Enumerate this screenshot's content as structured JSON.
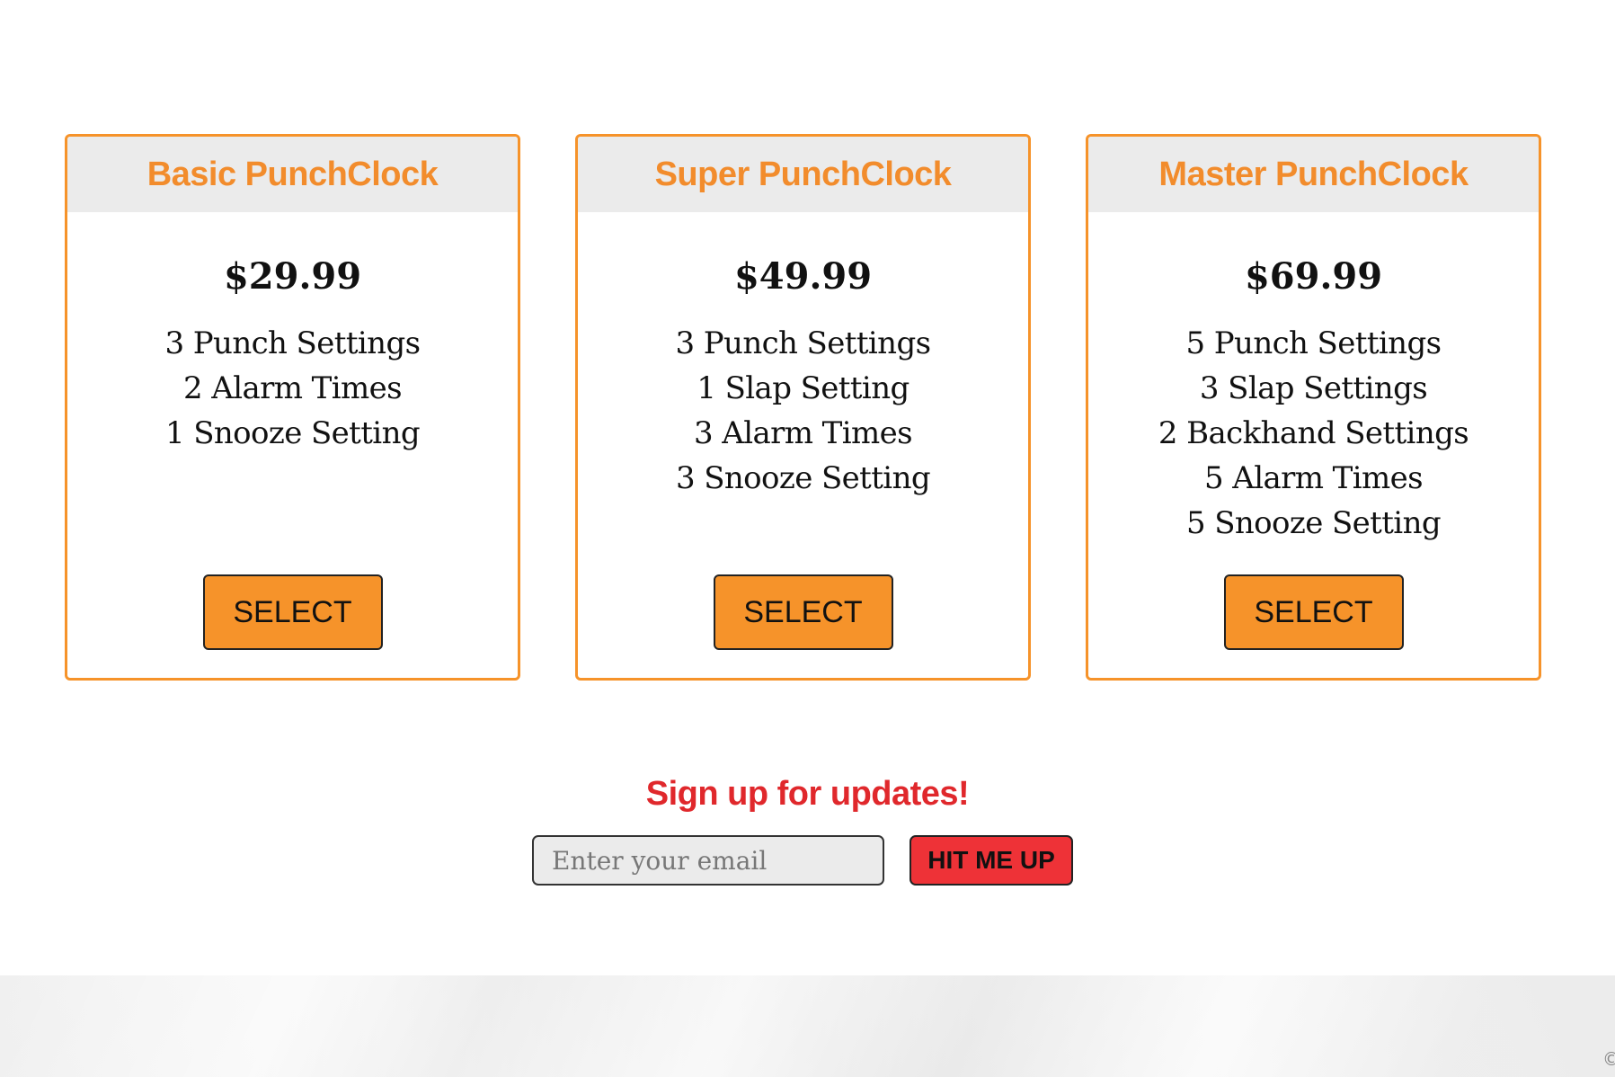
{
  "plans": [
    {
      "name": "Basic PunchClock",
      "price": "$29.99",
      "features": [
        "3 Punch Settings",
        "2 Alarm Times",
        "1 Snooze Setting"
      ],
      "button_label": "SELECT"
    },
    {
      "name": "Super PunchClock",
      "price": "$49.99",
      "features": [
        "3 Punch Settings",
        "1 Slap Setting",
        "3 Alarm Times",
        "3 Snooze Setting"
      ],
      "button_label": "SELECT"
    },
    {
      "name": "Master PunchClock",
      "price": "$69.99",
      "features": [
        "5 Punch Settings",
        "3 Slap Settings",
        "2 Backhand Settings",
        "5 Alarm Times",
        "5 Snooze Setting"
      ],
      "button_label": "SELECT"
    }
  ],
  "signup": {
    "title": "Sign up for updates!",
    "email_placeholder": "Enter your email",
    "email_value": "",
    "submit_label": "HIT ME UP"
  },
  "footer": {
    "copyright_symbol": "©"
  },
  "colors": {
    "accent_orange": "#f6932a",
    "heading_orange": "#f28c2c",
    "signup_red": "#e0282c",
    "button_red": "#ee3237",
    "header_gray": "#ebebeb"
  }
}
